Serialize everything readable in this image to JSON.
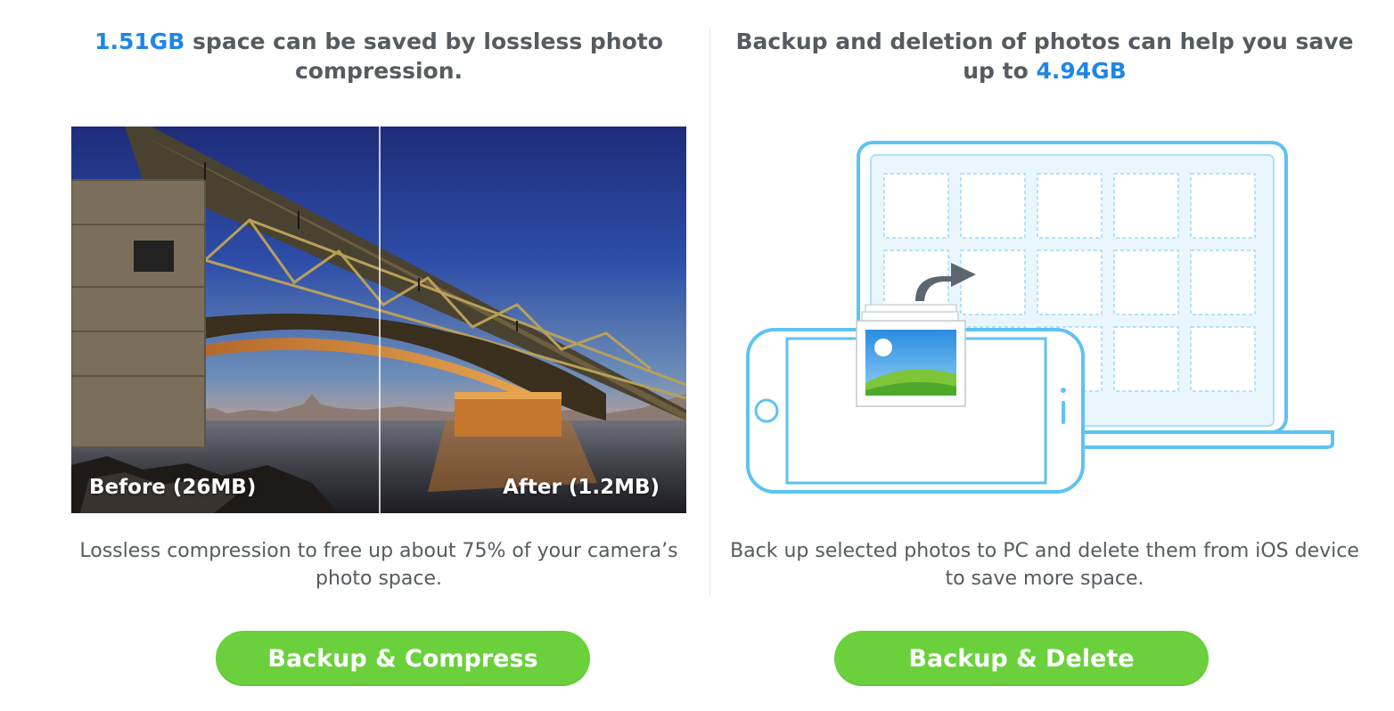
{
  "compress_panel": {
    "headline_amount": "1.51GB",
    "headline_rest": " space can be saved by lossless photo compression.",
    "before_label": "Before (26MB)",
    "after_label": "After (1.2MB)",
    "description": "Lossless compression to free up about 75% of your camera’s photo space.",
    "button_label": "Backup & Compress"
  },
  "delete_panel": {
    "headline_start": "Backup and deletion of photos can help you save up to ",
    "headline_amount": "4.94GB",
    "description": "Back up selected photos to PC and delete them from iOS device to save more space.",
    "button_label": "Backup & Delete"
  },
  "icons": {
    "laptop": "laptop-icon",
    "phone": "phone-icon",
    "photo_stack": "photo-stack-icon",
    "transfer_arrow": "transfer-arrow-icon"
  },
  "colors": {
    "accent": "#1f86e8",
    "button": "#6ad13c",
    "text": "#555b60",
    "device_outline": "#5ec3f2"
  }
}
